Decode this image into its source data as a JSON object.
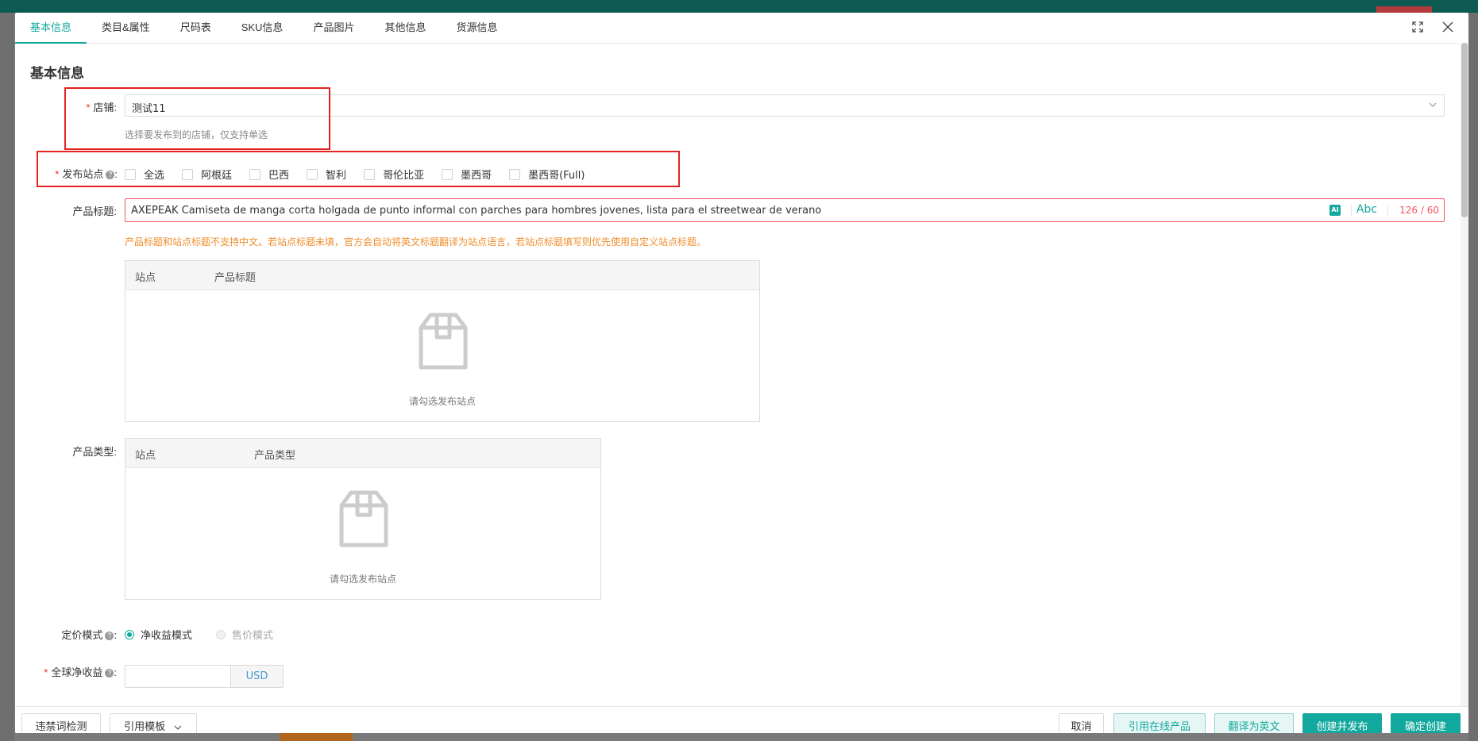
{
  "tabs": [
    "基本信息",
    "类目&属性",
    "尺码表",
    "SKU信息",
    "产品图片",
    "其他信息",
    "货源信息"
  ],
  "section_title": "基本信息",
  "store": {
    "label": "店铺:",
    "value": "测试11",
    "hint": "选择要发布到的店铺，仅支持单选"
  },
  "sites": {
    "label": "发布站点",
    "colon": ":",
    "options": [
      "全选",
      "阿根廷",
      "巴西",
      "智利",
      "哥伦比亚",
      "墨西哥",
      "墨西哥(Full)"
    ]
  },
  "product_title": {
    "label": "产品标题:",
    "value": "AXEPEAK Camiseta de manga corta holgada de punto informal con parches para hombres jovenes, lista para el streetwear de verano",
    "ai_badge": "AI",
    "abc": "Abc",
    "count": "126 / 60",
    "warning": "产品标题和站点标题不支持中文。若站点标题未填，官方会自动将英文标题翻译为站点语言，若站点标题填写则优先使用自定义站点标题。"
  },
  "title_table": {
    "col_site": "站点",
    "col_title": "产品标题",
    "empty": "请勾选发布站点"
  },
  "type_table": {
    "label": "产品类型:",
    "col_site": "站点",
    "col_type": "产品类型",
    "empty": "请勾选发布站点"
  },
  "pricing": {
    "label": "定价模式",
    "colon": ":",
    "options": [
      "净收益模式",
      "售价模式"
    ],
    "selected": "净收益模式"
  },
  "net_income": {
    "label": "全球净收益",
    "colon": ":",
    "unit": "USD"
  },
  "footer": {
    "check_words": "违禁词检测",
    "template": "引用模板",
    "cancel": "取消",
    "reference_online": "引用在线产品",
    "translate": "翻译为英文",
    "create_publish": "创建并发布",
    "confirm_create": "确定创建"
  },
  "colors": {
    "accent": "#13a89e",
    "error": "#f5535b",
    "warning": "#f08d2a",
    "highlight_box": "#e52222"
  }
}
